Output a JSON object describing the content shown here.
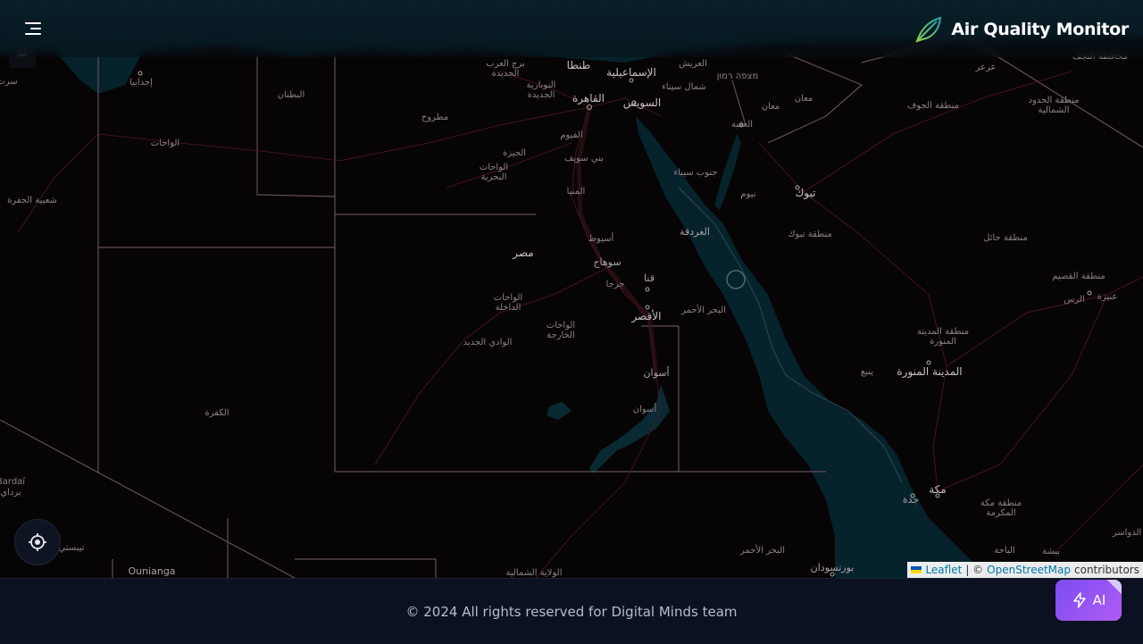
{
  "header": {
    "app_title": "Air Quality Monitor",
    "menu_icon": "hamburger-menu-icon",
    "logo_icon": "leaf-icon"
  },
  "map": {
    "zoom_out_label": "−",
    "labels": {
      "cairo": "القاهرة",
      "giza": "الجيزة",
      "suez": "السويس",
      "ismailia": "الإسماعيلية",
      "tanta": "طنطا",
      "borg": "برج العرب الجديدة",
      "nubaria": "النوبارية الجديدة",
      "arish": "العريش",
      "north_sinai": "شمال سيناء",
      "aqaba": "العقبة",
      "maan": "معان",
      "maan_city": "معان",
      "mitzpe": "מצפה רמון",
      "south_sinai": "جنوب سيناء",
      "tabuk": "تبوك",
      "tabuk_region": "منطقة تبوك",
      "neom": "نيوم",
      "hurghada": "الغردقة",
      "egypt": "مصر",
      "asyut": "أسيوط",
      "sohag": "سوهاج",
      "qena": "قنا",
      "girga": "جرجا",
      "luxor": "الأقصر",
      "red_sea_gov": "البحر الأحمر",
      "aswan": "أسوان",
      "aswan2": "أسوان",
      "dakhla": "الواحات الداخلة",
      "kharga": "الواحات الخارجة",
      "new_valley": "الوادي الجديد",
      "bahariya": "الواحات البحرية",
      "fayoum": "الفيوم",
      "beni_suef": "بني سويف",
      "minya": "المنيا",
      "matruh": "مطروح",
      "batnan": "البطنان",
      "ajdabiya": "إجدابيا",
      "wahat": "الواحات",
      "jufra": "شعبية الجفرة",
      "kufra": "الكفرة",
      "bardai": "Bardaï",
      "bardai_ar": "برداي",
      "tibesti": "تيبستي",
      "ounianga": "Ounianga",
      "northern_state": "الولاية الشمالية",
      "red_sea_sd": "البحر الأحمر",
      "port_sudan": "بورتسودان",
      "madinah": "المدينة المنورة",
      "madinah_region": "منطقة المدينة المنورة",
      "yanbu": "ينبع",
      "makkah": "مكة",
      "makkah_region": "منطقة مكة المكرمة",
      "jeddah": "جدة",
      "baha": "الباحة",
      "bisha": "بيشة",
      "dawasir": "الدواسر",
      "jouf": "منطقة الجوف",
      "northern_borders": "منطقة الحدود الشمالية",
      "hail": "منطقة حائل",
      "qassim": "منطقة القصيم",
      "rass": "الرس",
      "unaizah": "عنيزة",
      "arar": "عرعر",
      "najaf": "محافظة النجف",
      "sirte": "سرت"
    }
  },
  "locate_button": {
    "icon": "crosshair-locate-icon"
  },
  "attribution": {
    "flag_icon": "ukraine-flag-icon",
    "leaflet": "Leaflet",
    "sep": "| ©",
    "osm": "OpenStreetMap",
    "contributors": "contributors"
  },
  "footer": {
    "copyright": "© 2024 All rights reserved for Digital Minds team"
  },
  "ai_button": {
    "label": "AI",
    "icon": "lightning-icon"
  },
  "colors": {
    "land": "#070405",
    "water": "#06222b",
    "borders": "#6b5560",
    "roads": "#4a1418",
    "accent_ai": "#9a55f3",
    "footer_bg": "#0b1120"
  }
}
